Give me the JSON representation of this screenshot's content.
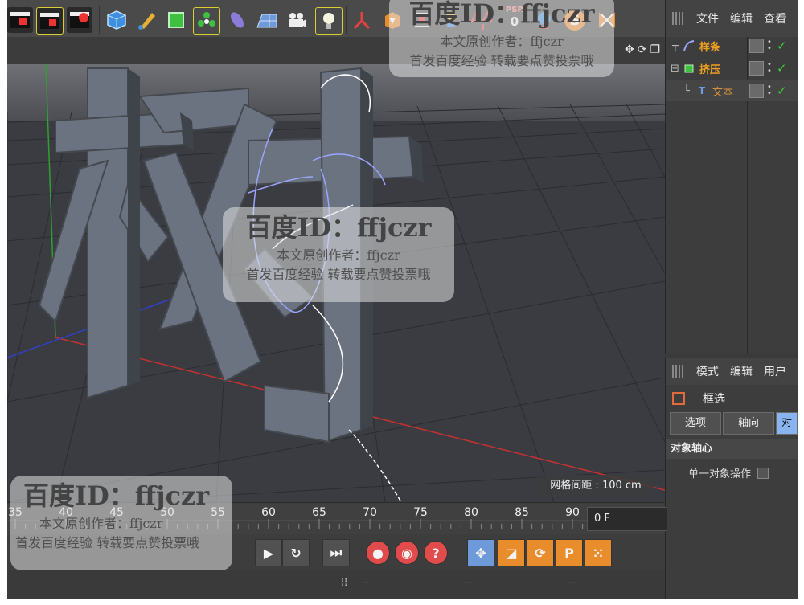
{
  "toolbar": {
    "psr_label": "PSR",
    "psr_value": "0",
    "icons": [
      "clapper-icon",
      "clapper-render-icon",
      "clapper-settings-icon",
      "cube-icon",
      "pen-icon",
      "subdivision-icon",
      "array-icon",
      "deformer-icon",
      "floor-icon",
      "camera-icon",
      "light-icon",
      "axis-icon",
      "tag-icon",
      "snap-icon",
      "psr-icon",
      "sphere-icon",
      "s-icon",
      "close-icon"
    ]
  },
  "viewport": {
    "grid_info": "网格间距 : 100 cm",
    "header_icons": [
      "move-view-icon",
      "rotate-view-icon",
      "maximize-view-icon"
    ]
  },
  "object_manager": {
    "tabs": [
      "文件",
      "编辑",
      "查看"
    ],
    "objects": [
      {
        "name": "样条",
        "icon": "spline-icon"
      },
      {
        "name": "挤压",
        "icon": "extrude-icon"
      },
      {
        "name": "文本",
        "icon": "text-icon"
      }
    ]
  },
  "attribute_manager": {
    "tabs": [
      "模式",
      "编辑",
      "用户"
    ],
    "select_label": "框选",
    "sub_tabs": [
      "选项",
      "轴向",
      "对"
    ],
    "section_title": "对象轴心",
    "option_label": "单一对象操作"
  },
  "timeline": {
    "ticks": [
      "35",
      "40",
      "45",
      "50",
      "55",
      "60",
      "65",
      "70",
      "75",
      "80",
      "85",
      "90"
    ],
    "current_frame": "0 F"
  },
  "status_bar": {
    "items": [
      "--",
      "--",
      "--"
    ]
  },
  "watermarks": [
    {
      "line1": "百度ID：ffjczr",
      "line2": "本文原创作者：ffjczr",
      "line3": "首发百度经验  转载要点赞投票哦"
    },
    {
      "line1": "百度ID：ffjczr",
      "line2": "本文原创作者：ffjczr",
      "line3": "首发百度经验  转载要点赞投票哦"
    },
    {
      "line1": "百度ID：ffjczr",
      "line2": "本文原创作者：ffjczr",
      "line3": "首发百度经验  转载要点赞投票哦"
    }
  ],
  "colors": {
    "accent_orange": "#f0a020",
    "active_tab": "#8ab4f0",
    "visible_check": "#3ccd3c",
    "x_axis": "#c83030",
    "y_axis": "#30a030",
    "z_axis": "#3040c8"
  }
}
